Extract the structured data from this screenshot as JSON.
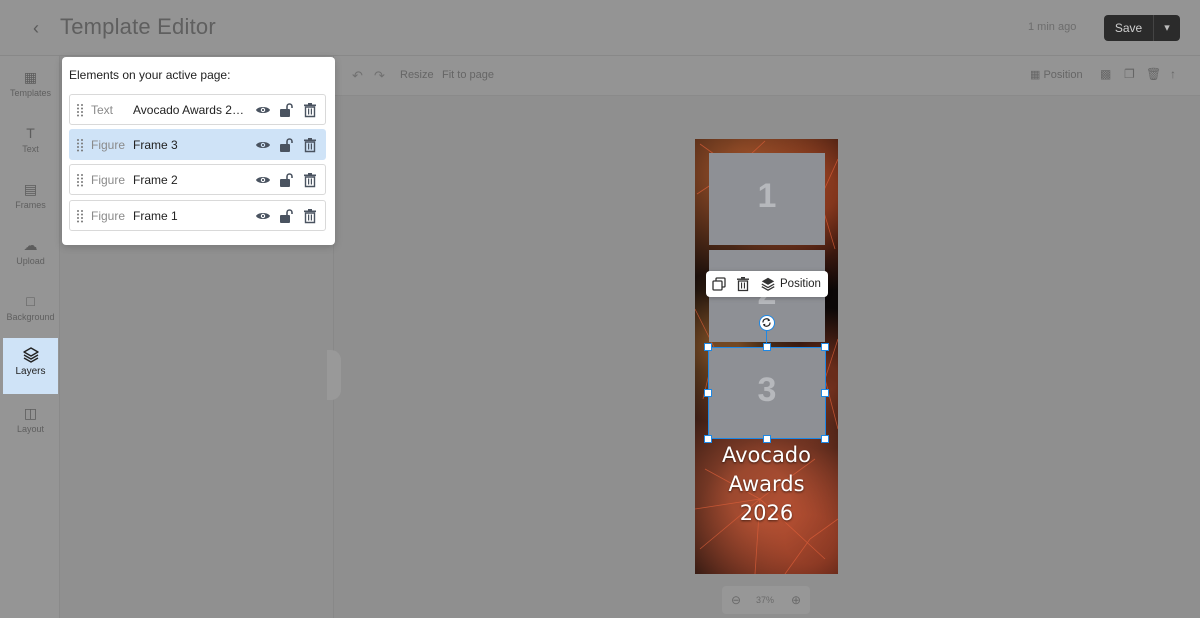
{
  "header": {
    "title": "Template Editor",
    "saved_note": "1 min ago",
    "save_label": "Save"
  },
  "rail": {
    "items": [
      {
        "label": "Templates",
        "icon": "grid-icon"
      },
      {
        "label": "Text",
        "icon": "text-icon"
      },
      {
        "label": "Frames",
        "icon": "frames-icon"
      },
      {
        "label": "Upload",
        "icon": "upload-icon"
      },
      {
        "label": "Background",
        "icon": "background-icon"
      },
      {
        "label": "Layers",
        "icon": "layers-icon",
        "active": true
      },
      {
        "label": "Layout",
        "icon": "layout-icon"
      }
    ]
  },
  "toolbar": {
    "resize_label": "Resize",
    "fit_label": "Fit to page",
    "position_label": "Position"
  },
  "layers_panel": {
    "title": "Elements on your active page:",
    "rows": [
      {
        "type": "Text",
        "name": "Avocado Awards 2026",
        "selected": false
      },
      {
        "type": "Figure",
        "name": "Frame 3",
        "selected": true
      },
      {
        "type": "Figure",
        "name": "Frame 2",
        "selected": false
      },
      {
        "type": "Figure",
        "name": "Frame 1",
        "selected": false
      }
    ]
  },
  "artboard": {
    "frames": [
      "1",
      "2",
      "3"
    ],
    "title_lines": [
      "Avocado",
      "Awards",
      "2026"
    ]
  },
  "context_toolbar": {
    "position_label": "Position"
  },
  "zoom": {
    "value": "37%"
  },
  "colors": {
    "accent": "#1e88e5",
    "selected_row": "#cfe3f7",
    "frame_fill": "#8e9095"
  }
}
